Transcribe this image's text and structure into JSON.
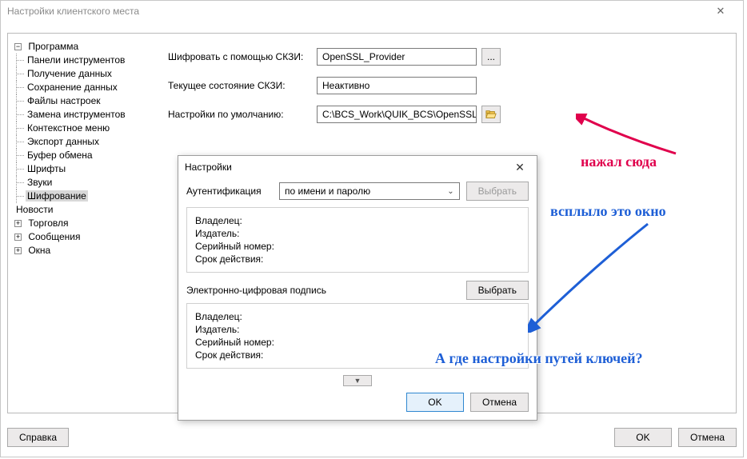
{
  "window": {
    "title": "Настройки клиентского места",
    "close_glyph": "✕"
  },
  "tree": {
    "program": {
      "label": "Программа",
      "toggle": "−",
      "items": [
        "Панели инструментов",
        "Получение данных",
        "Сохранение данных",
        "Файлы настроек",
        "Замена инструментов",
        "Контекстное меню",
        "Экспорт данных",
        "Буфер обмена",
        "Шрифты",
        "Звуки",
        "Шифрование"
      ],
      "selected_index": 10
    },
    "nodes": [
      {
        "label": "Новости",
        "toggle": ""
      },
      {
        "label": "Торговля",
        "toggle": "+"
      },
      {
        "label": "Сообщения",
        "toggle": "+"
      },
      {
        "label": "Окна",
        "toggle": "+"
      }
    ]
  },
  "form": {
    "row1": {
      "label": "Шифровать с помощью СКЗИ:",
      "value": "OpenSSL_Provider",
      "ellipsis": "..."
    },
    "row2": {
      "label": "Текущее состояние СКЗИ:",
      "value": "Неактивно"
    },
    "row3": {
      "label": "Настройки по умолчанию:",
      "value": "C:\\BCS_Work\\QUIK_BCS\\OpenSSL"
    }
  },
  "main_buttons": {
    "help": "Справка",
    "ok": "OK",
    "cancel": "Отмена"
  },
  "dialog": {
    "title": "Настройки",
    "close_glyph": "✕",
    "auth_label": "Аутентификация",
    "auth_value": "по имени и паролю",
    "select_btn": "Выбрать",
    "fields": {
      "owner": "Владелец:",
      "issuer": "Издатель:",
      "serial": "Серийный номер:",
      "expiry": "Срок действия:"
    },
    "eds_label": "Электронно-цифровая подпись",
    "expand_glyph": "▼",
    "ok": "OK",
    "cancel": "Отмена"
  },
  "annotations": {
    "a1": "нажал сюда",
    "a2": "всплыло это окно",
    "a3": "А где настройки путей ключей?"
  }
}
